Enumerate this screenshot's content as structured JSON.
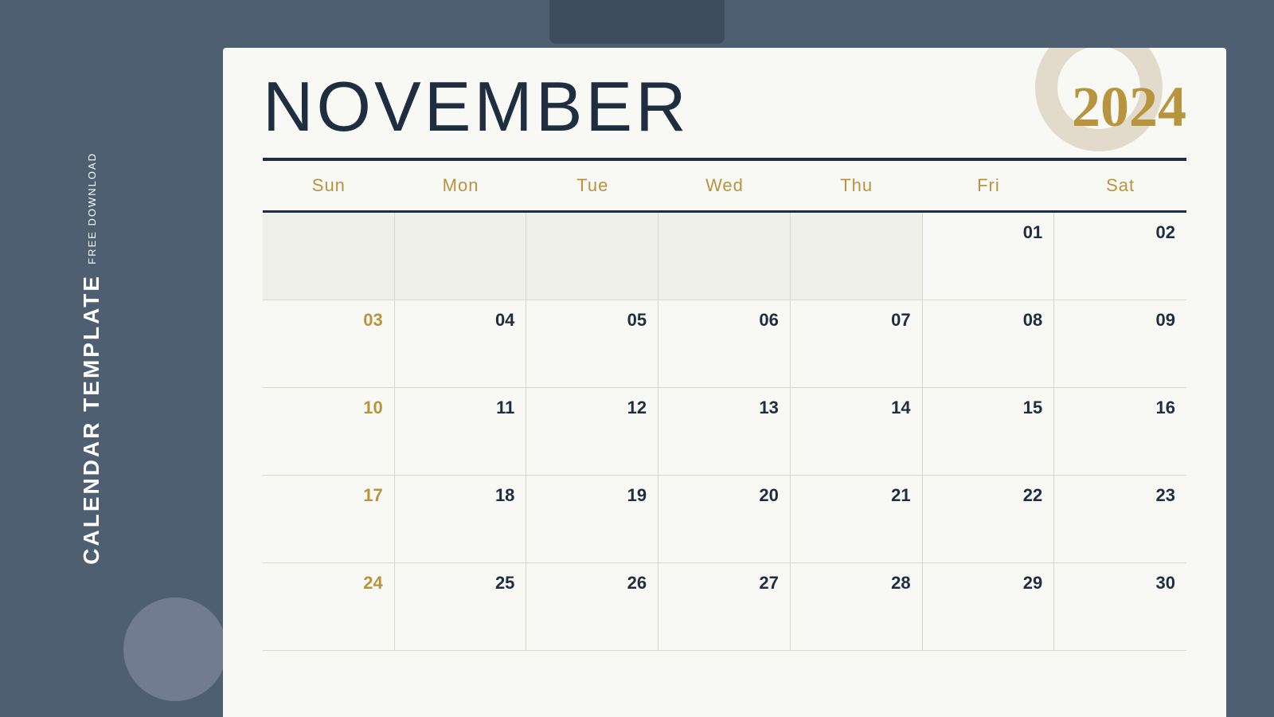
{
  "background_color": "#4f5f72",
  "sidebar": {
    "free_download_label": "FREE DOWNLOAD",
    "calendar_template_label": "CALENDAR TEMPLATE"
  },
  "calendar": {
    "month": "NOVEMBER",
    "year": "2024",
    "day_headers": [
      "Sun",
      "Mon",
      "Tue",
      "Wed",
      "Thu",
      "Fri",
      "Sat"
    ],
    "weeks": [
      [
        {
          "day": "",
          "empty": true
        },
        {
          "day": "",
          "empty": true
        },
        {
          "day": "",
          "empty": true
        },
        {
          "day": "",
          "empty": true
        },
        {
          "day": "",
          "empty": true
        },
        {
          "day": "01",
          "sunday": false
        },
        {
          "day": "02",
          "sunday": false
        }
      ],
      [
        {
          "day": "03",
          "sunday": true
        },
        {
          "day": "04",
          "sunday": false
        },
        {
          "day": "05",
          "sunday": false
        },
        {
          "day": "06",
          "sunday": false
        },
        {
          "day": "07",
          "sunday": false
        },
        {
          "day": "08",
          "sunday": false
        },
        {
          "day": "09",
          "sunday": false
        }
      ],
      [
        {
          "day": "10",
          "sunday": true
        },
        {
          "day": "11",
          "sunday": false
        },
        {
          "day": "12",
          "sunday": false
        },
        {
          "day": "13",
          "sunday": false
        },
        {
          "day": "14",
          "sunday": false
        },
        {
          "day": "15",
          "sunday": false
        },
        {
          "day": "16",
          "sunday": false
        }
      ],
      [
        {
          "day": "17",
          "sunday": true
        },
        {
          "day": "18",
          "sunday": false
        },
        {
          "day": "19",
          "sunday": false
        },
        {
          "day": "20",
          "sunday": false
        },
        {
          "day": "21",
          "sunday": false
        },
        {
          "day": "22",
          "sunday": false
        },
        {
          "day": "23",
          "sunday": false
        }
      ],
      [
        {
          "day": "24",
          "sunday": true
        },
        {
          "day": "25",
          "sunday": false
        },
        {
          "day": "26",
          "sunday": false
        },
        {
          "day": "27",
          "sunday": false
        },
        {
          "day": "28",
          "sunday": false
        },
        {
          "day": "29",
          "sunday": false
        },
        {
          "day": "30",
          "sunday": false
        }
      ]
    ]
  }
}
